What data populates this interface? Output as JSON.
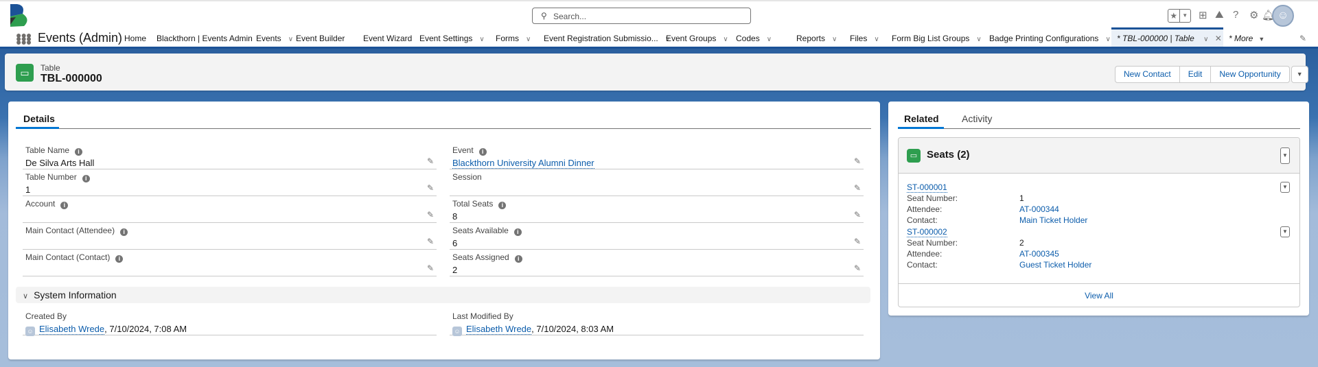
{
  "header": {
    "search_placeholder": "Search...",
    "icons": [
      "favorites-star-icon",
      "add-icon",
      "trailhead-icon",
      "help-icon",
      "setup-gear-icon",
      "notifications-bell-icon",
      "user-avatar"
    ]
  },
  "nav": {
    "app_name": "Events (Admin)",
    "items": [
      {
        "label": "Home",
        "has_menu": false
      },
      {
        "label": "Blackthorn | Events Admin",
        "has_menu": false
      },
      {
        "label": "Events",
        "has_menu": true
      },
      {
        "label": "Event Builder",
        "has_menu": false
      },
      {
        "label": "Event Wizard",
        "has_menu": false
      },
      {
        "label": "Event Settings",
        "has_menu": true
      },
      {
        "label": "Forms",
        "has_menu": true
      },
      {
        "label": "Event Registration Submissio...",
        "has_menu": true
      },
      {
        "label": "Event Groups",
        "has_menu": true
      },
      {
        "label": "Codes",
        "has_menu": true
      },
      {
        "label": "Reports",
        "has_menu": true
      },
      {
        "label": "Files",
        "has_menu": true
      },
      {
        "label": "Form Big List Groups",
        "has_menu": true
      },
      {
        "label": "Badge Printing Configurations",
        "has_menu": true
      }
    ],
    "active_tab": "* TBL-000000 | Table",
    "more": "* More"
  },
  "record": {
    "object_type": "Table",
    "name": "TBL-000000",
    "actions": [
      "New Contact",
      "Edit",
      "New Opportunity"
    ]
  },
  "details": {
    "tab": "Details",
    "left_fields": [
      {
        "label": "Table Name",
        "value": "De Silva Arts Hall",
        "info": true
      },
      {
        "label": "Table Number",
        "value": "1",
        "info": true
      },
      {
        "label": "Account",
        "value": "",
        "info": true
      },
      {
        "label": "Main Contact (Attendee)",
        "value": "",
        "info": true
      },
      {
        "label": "Main Contact (Contact)",
        "value": "",
        "info": true
      }
    ],
    "right_fields": [
      {
        "label": "Event",
        "value": "Blackthorn University Alumni Dinner",
        "info": true,
        "link": true
      },
      {
        "label": "Session",
        "value": "",
        "info": false
      },
      {
        "label": "Total Seats",
        "value": "8",
        "info": true
      },
      {
        "label": "Seats Available",
        "value": "6",
        "info": true
      },
      {
        "label": "Seats Assigned",
        "value": "2",
        "info": true
      }
    ],
    "system_section": "System Information",
    "created_by": {
      "label": "Created By",
      "user": "Elisabeth Wrede",
      "date": ", 7/10/2024, 7:08 AM"
    },
    "modified_by": {
      "label": "Last Modified By",
      "user": "Elisabeth Wrede",
      "date": ", 7/10/2024, 8:03 AM"
    }
  },
  "related": {
    "tabs": [
      "Related",
      "Activity"
    ],
    "seats": {
      "title": "Seats (2)",
      "records": [
        {
          "name": "ST-000001",
          "seat_label": "Seat Number:",
          "seat": "1",
          "attendee_label": "Attendee:",
          "attendee": "AT-000344",
          "contact_label": "Contact:",
          "contact": "Main Ticket Holder"
        },
        {
          "name": "ST-000002",
          "seat_label": "Seat Number:",
          "seat": "2",
          "attendee_label": "Attendee:",
          "attendee": "AT-000345",
          "contact_label": "Contact:",
          "contact": "Guest Ticket Holder"
        }
      ],
      "view_all": "View All"
    }
  },
  "colors": {
    "brand_blue": "#1b5297",
    "link": "#0b5cab",
    "table_icon": "#2e9e4f",
    "tab_active": "#0176d3"
  }
}
